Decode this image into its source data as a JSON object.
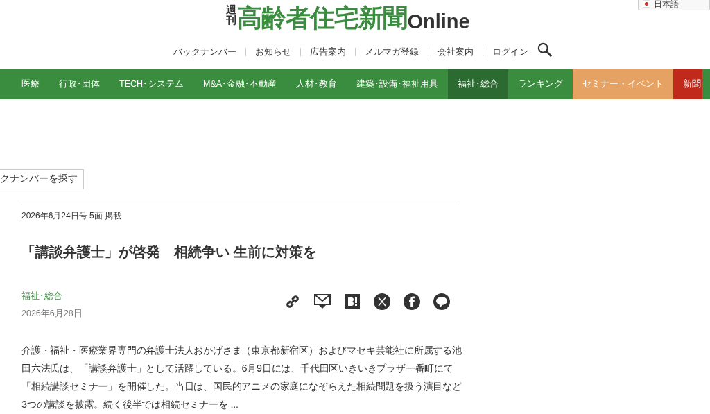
{
  "language": {
    "label": "日本語"
  },
  "logo": {
    "small": "週刊",
    "main": "高齢者住宅新聞",
    "suffix": "Online"
  },
  "top_links": [
    "バックナンバー",
    "お知らせ",
    "広告案内",
    "メルマガ登録",
    "会社案内",
    "ログイン"
  ],
  "nav": [
    {
      "label": "医療",
      "selected": false,
      "kind": "category"
    },
    {
      "label": "行政･団体",
      "selected": false,
      "kind": "category"
    },
    {
      "label": "TECH･システム",
      "selected": false,
      "kind": "category"
    },
    {
      "label": "M&A･金融･不動産",
      "selected": false,
      "kind": "category"
    },
    {
      "label": "人材･教育",
      "selected": false,
      "kind": "category"
    },
    {
      "label": "建築･設備･福祉用具",
      "selected": false,
      "kind": "category"
    },
    {
      "label": "福祉･総合",
      "selected": true,
      "kind": "category"
    },
    {
      "label": "ランキング",
      "selected": false,
      "kind": "category"
    },
    {
      "label": "セミナー・イベント",
      "selected": false,
      "kind": "event"
    },
    {
      "label": "新聞",
      "selected": false,
      "kind": "paper"
    }
  ],
  "backnumber_button": "クナンバーを探す",
  "article": {
    "issue": "2026年6月24日号  5面 掲載",
    "title": "「講談弁護士」が啓発　相続争い 生前に対策を",
    "category": "福祉･総合",
    "date": "2026年6月28日",
    "body": "介護・福祉・医療業界専門の弁護士法人おかげさま（東京都新宿区）およびマセキ芸能社に所属する池田六法氏は、「講談弁護士」として活躍している。6月9日には、千代田区いきいきプラザ一番町にて「相続講談セミナー」を開催した。当日は、国民的アニメの家庭になぞらえた相続問題を扱う演目など3つの講談を披露。続く後半では相続セミナーを ..."
  }
}
